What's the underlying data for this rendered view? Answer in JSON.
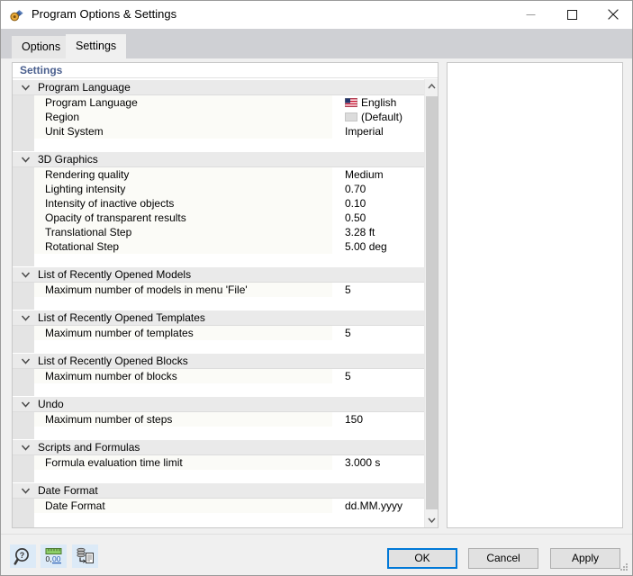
{
  "window": {
    "title": "Program Options & Settings",
    "icon": "key-lock-icon",
    "controls": {
      "minimize": "minimize-icon",
      "maximize": "maximize-icon",
      "close": "close-icon"
    }
  },
  "tabs": [
    {
      "label": "Options",
      "active": false
    },
    {
      "label": "Settings",
      "active": true
    }
  ],
  "tree": {
    "header": "Settings",
    "header_color": "#4a5f8e",
    "groups": [
      {
        "title": "Program Language",
        "expanded": true,
        "items": [
          {
            "label": "Program Language",
            "value": "English",
            "icon": "us-flag-icon"
          },
          {
            "label": "Region",
            "value": "(Default)",
            "icon": "blank-flag-icon"
          },
          {
            "label": "Unit System",
            "value": "Imperial",
            "icon": null
          }
        ]
      },
      {
        "title": "3D Graphics",
        "expanded": true,
        "items": [
          {
            "label": "Rendering quality",
            "value": "Medium",
            "icon": null
          },
          {
            "label": "Lighting intensity",
            "value": "0.70",
            "icon": null
          },
          {
            "label": "Intensity of inactive objects",
            "value": "0.10",
            "icon": null
          },
          {
            "label": "Opacity of transparent results",
            "value": "0.50",
            "icon": null
          },
          {
            "label": "Translational Step",
            "value": "3.28 ft",
            "icon": null
          },
          {
            "label": "Rotational Step",
            "value": "5.00 deg",
            "icon": null
          }
        ]
      },
      {
        "title": "List of Recently Opened Models",
        "expanded": true,
        "items": [
          {
            "label": "Maximum number of models in menu 'File'",
            "value": "5",
            "icon": null
          }
        ]
      },
      {
        "title": "List of Recently Opened Templates",
        "expanded": true,
        "items": [
          {
            "label": "Maximum number of templates",
            "value": "5",
            "icon": null
          }
        ]
      },
      {
        "title": "List of Recently Opened Blocks",
        "expanded": true,
        "items": [
          {
            "label": "Maximum number of blocks",
            "value": "5",
            "icon": null
          }
        ]
      },
      {
        "title": "Undo",
        "expanded": true,
        "items": [
          {
            "label": "Maximum number of steps",
            "value": "150",
            "icon": null
          }
        ]
      },
      {
        "title": "Scripts and Formulas",
        "expanded": true,
        "items": [
          {
            "label": "Formula evaluation time limit",
            "value": "3.000 s",
            "icon": null
          }
        ]
      },
      {
        "title": "Date Format",
        "expanded": true,
        "items": [
          {
            "label": "Date Format",
            "value": "dd.MM.yyyy",
            "icon": null
          }
        ]
      }
    ]
  },
  "scrollbar": {
    "up_arrow": "chevron-up-icon",
    "down_arrow": "chevron-down-icon"
  },
  "description_panel": {
    "content": ""
  },
  "toolbar": [
    {
      "name": "help-search-icon",
      "tooltip": "Help"
    },
    {
      "name": "units-ruler-icon",
      "tooltip": "Units and Decimal Places",
      "text": "0,00"
    },
    {
      "name": "import-settings-icon",
      "tooltip": "Import / Export"
    }
  ],
  "buttons": {
    "ok": "OK",
    "cancel": "Cancel",
    "apply": "Apply"
  },
  "colors": {
    "accent": "#0078d7",
    "header_text": "#4a5f8e",
    "tab_strip": "#cfd0d4",
    "group_row": "#eaeaea",
    "label_cell": "#fbfbf7",
    "gutter": "#e4e4e4",
    "toolbtn_bg": "#dceaf7"
  }
}
